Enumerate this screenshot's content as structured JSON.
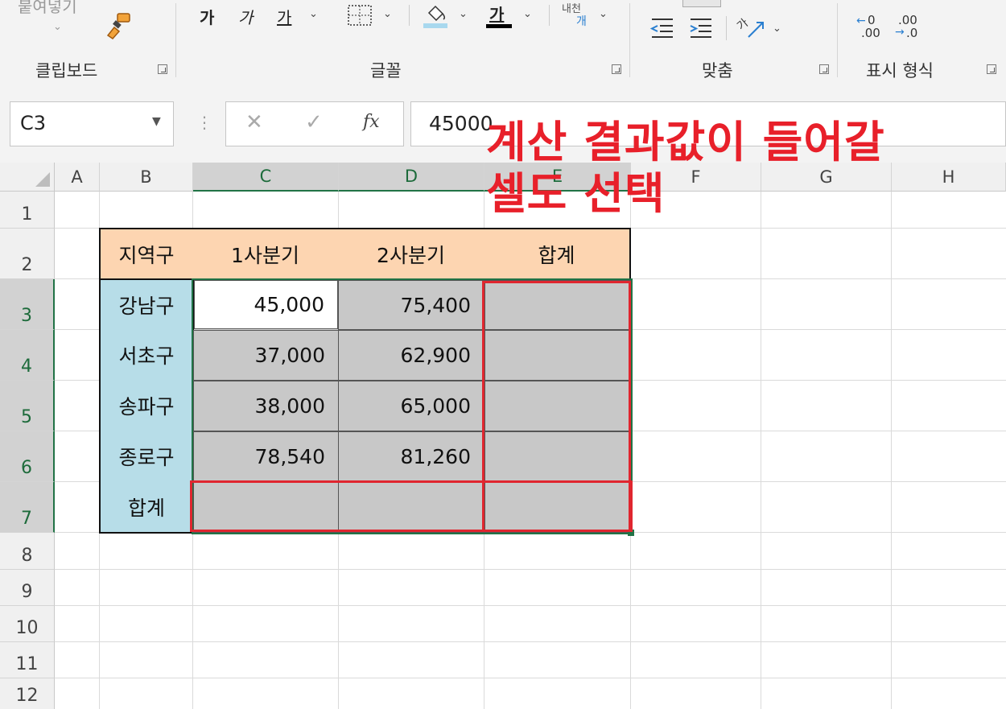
{
  "ribbon": {
    "paste_label": "붙여넣기",
    "groups": {
      "clipboard": "클립보드",
      "font": "글꼴",
      "alignment": "맞춤",
      "number": "표시 형식"
    },
    "font_buttons": {
      "bold": "가",
      "italic": "가",
      "underline": "가"
    },
    "font_color_letter": "가",
    "phonetic_label": "내천",
    "phonetic_sub": "개",
    "orientation_glyph": "가",
    "increase_decimal": ".00",
    "decrease_decimal": ".0"
  },
  "formula_bar": {
    "name_box": "C3",
    "cancel_glyph": "✕",
    "enter_glyph": "✓",
    "fx_label": "fx",
    "value": "45000"
  },
  "columns": [
    "A",
    "B",
    "C",
    "D",
    "E",
    "F",
    "G",
    "H"
  ],
  "rows": [
    "1",
    "2",
    "3",
    "4",
    "5",
    "6",
    "7",
    "8",
    "9",
    "10",
    "11",
    "12"
  ],
  "table": {
    "headers": [
      "지역구",
      "1사분기",
      "2사분기",
      "합계"
    ],
    "rows": [
      {
        "region": "강남구",
        "q1": "45,000",
        "q2": "75,400",
        "total": ""
      },
      {
        "region": "서초구",
        "q1": "37,000",
        "q2": "62,900",
        "total": ""
      },
      {
        "region": "송파구",
        "q1": "38,000",
        "q2": "65,000",
        "total": ""
      },
      {
        "region": "종로구",
        "q1": "78,540",
        "q2": "81,260",
        "total": ""
      }
    ],
    "total_row": {
      "label": "합계",
      "q1": "",
      "q2": "",
      "total": ""
    }
  },
  "annotation": {
    "line1": "계산 결과값이 들어갈",
    "line2": "셀도 선택"
  },
  "colors": {
    "accent_green": "#217346",
    "annotation_red": "#e8202a",
    "header_fill": "#fdd5b1",
    "label_fill": "#b7dde8",
    "selection_fill": "#c8c8c8"
  }
}
